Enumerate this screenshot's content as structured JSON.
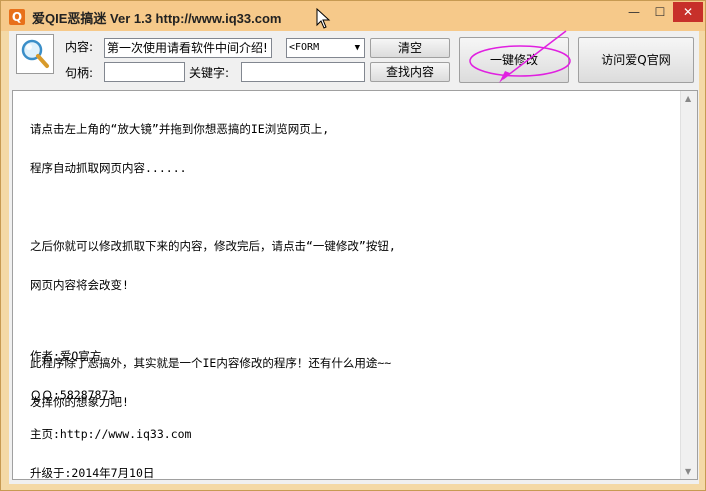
{
  "window": {
    "title": "爱QIE恶搞迷 Ver 1.3 http://www.iq33.com",
    "icon_letter": "Q",
    "minimize_glyph": "—",
    "maximize_glyph": "☐",
    "close_glyph": "✕"
  },
  "toolbar": {
    "content_label": "内容:",
    "content_value": "第一次使用请看软件中间介绍!",
    "form_select_value": "<FORM",
    "handle_label": "句柄:",
    "handle_value": "",
    "keyword_label": "关键字:",
    "keyword_value": "",
    "clear_button": "清空",
    "find_button": "查找内容",
    "modify_button": "一键修改",
    "visit_button": "访问爱Q官网"
  },
  "content": {
    "lines": [
      "请点击左上角的“放大镜”并拖到你想恶搞的IE浏览网页上,",
      "程序自动抓取网页内容......",
      "",
      "之后你就可以修改抓取下来的内容，修改完后，请点击“一键修改”按钮,",
      "网页内容将会改变!",
      "",
      "此程序除了恶搞外，其实就是一个IE内容修改的程序！还有什么用途~~",
      "发挥你的想象力吧!"
    ],
    "info_lines": [
      "作者:爱Q官方",
      "ＱＱ:58287873",
      "主页:http://www.iq33.com",
      "升级于:2014年7月10日"
    ]
  },
  "colors": {
    "titlebar": "#f6c98a",
    "annotation": "#e020e0"
  }
}
